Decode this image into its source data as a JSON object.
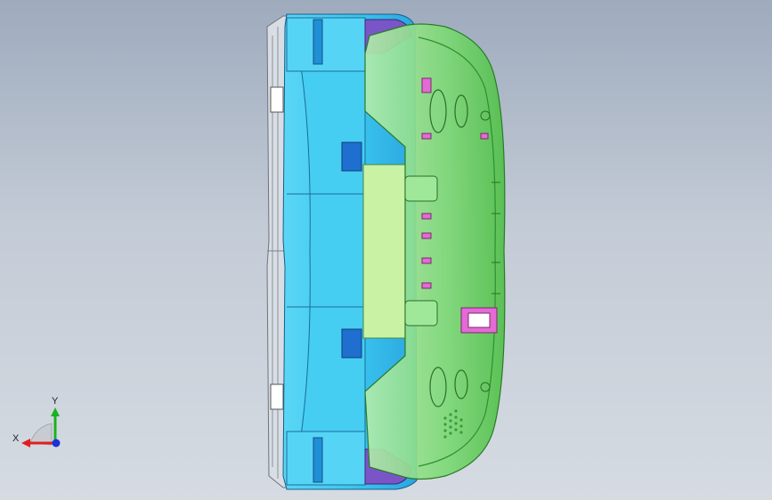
{
  "viewport": {
    "background_top": "#9eabbd",
    "background_bottom": "#d6dbe2"
  },
  "model": {
    "colors": {
      "bezel": "#d9dde4",
      "housing": "#3cc8f0",
      "housing_dark": "#1f8fd6",
      "window": "#7ee3f7",
      "back_cover": "#5fd15a",
      "back_cover_light": "#9fe89a",
      "connector": "#e46ad6",
      "rim": "#7a55c8"
    }
  },
  "triad": {
    "x_label": "X",
    "y_label": "Y",
    "x_color": "#e0201e",
    "y_color": "#19b21e",
    "z_color": "#1e2fd8"
  }
}
